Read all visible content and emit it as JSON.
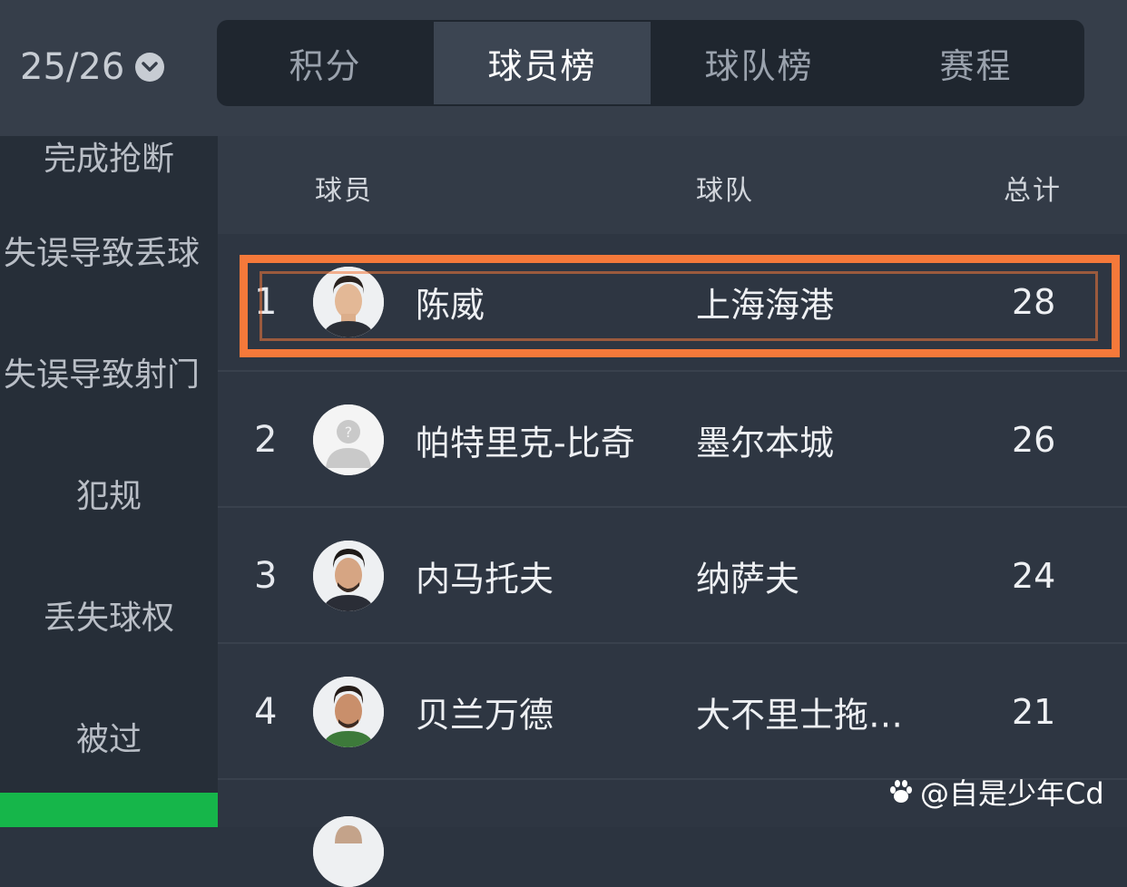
{
  "header": {
    "season": "25/26",
    "tabs": [
      {
        "label": "积分",
        "active": false
      },
      {
        "label": "球员榜",
        "active": true
      },
      {
        "label": "球队榜",
        "active": false
      },
      {
        "label": "赛程",
        "active": false
      }
    ]
  },
  "sidebar": {
    "items": [
      "完成抢断",
      "失误导致丢球",
      "失误导致射门",
      "犯规",
      "丢失球权",
      "被过"
    ],
    "selected_color": "#16b64a"
  },
  "table": {
    "columns": {
      "player": "球员",
      "team": "球队",
      "total": "总计"
    },
    "rows": [
      {
        "rank": "1",
        "player": "陈威",
        "team": "上海海港",
        "total": "28",
        "avatar": "player-photo-icon"
      },
      {
        "rank": "2",
        "player": "帕特里克-比奇",
        "team": "墨尔本城",
        "total": "26",
        "avatar": "placeholder-person-icon"
      },
      {
        "rank": "3",
        "player": "内马托夫",
        "team": "纳萨夫",
        "total": "24",
        "avatar": "player-photo-icon"
      },
      {
        "rank": "4",
        "player": "贝兰万德",
        "team": "大不里士拖…",
        "total": "21",
        "avatar": "player-photo-icon"
      }
    ],
    "highlight_color": "#f5793a"
  },
  "watermark": {
    "text": "@自是少年Cd",
    "icon": "baidu-paw-icon"
  }
}
